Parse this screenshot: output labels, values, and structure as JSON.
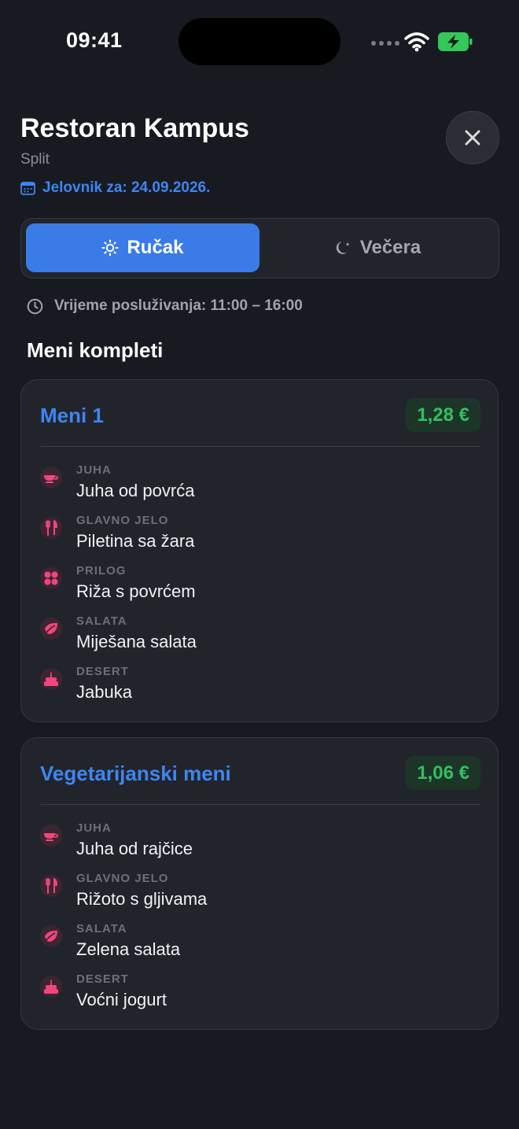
{
  "status_bar": {
    "time": "09:41"
  },
  "header": {
    "title": "Restoran Kampus",
    "city": "Split",
    "date_label": "Jelovnik za: 24.09.2026."
  },
  "meal_tabs": [
    {
      "label": "Ručak",
      "icon": "sun-icon",
      "selected": true
    },
    {
      "label": "Večera",
      "icon": "moon-icon",
      "selected": false
    }
  ],
  "serving_time": "Vrijeme posluživanja: 11:00 – 16:00",
  "section_title": "Meni kompleti",
  "menus": [
    {
      "name": "Meni 1",
      "price": "1,28 €",
      "items": [
        {
          "category": "JUHA",
          "dish": "Juha od povrća",
          "icon": "soup-bowl-icon"
        },
        {
          "category": "GLAVNO JELO",
          "dish": "Piletina sa žara",
          "icon": "fork-knife-icon"
        },
        {
          "category": "PRILOG",
          "dish": "Riža s povrćem",
          "icon": "grains-icon"
        },
        {
          "category": "SALATA",
          "dish": "Miješana salata",
          "icon": "leaf-icon"
        },
        {
          "category": "DESERT",
          "dish": "Jabuka",
          "icon": "cake-icon"
        }
      ]
    },
    {
      "name": "Vegetarijanski meni",
      "price": "1,06 €",
      "items": [
        {
          "category": "JUHA",
          "dish": "Juha od rajčice",
          "icon": "soup-bowl-icon"
        },
        {
          "category": "GLAVNO JELO",
          "dish": "Rižoto s gljivama",
          "icon": "fork-knife-icon"
        },
        {
          "category": "SALATA",
          "dish": "Zelena salata",
          "icon": "leaf-icon"
        },
        {
          "category": "DESERT",
          "dish": "Voćni jogurt",
          "icon": "cake-icon"
        }
      ]
    }
  ],
  "colors": {
    "accent": "#3a7be8",
    "price_text": "#31c061",
    "icon_pink": "#f0457d",
    "background": "#181a22"
  }
}
